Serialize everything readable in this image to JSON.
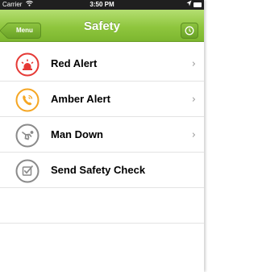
{
  "status_bar": {
    "carrier": "Carrier",
    "time": "3:50 PM"
  },
  "nav": {
    "back_label": "Menu",
    "title": "Safety"
  },
  "rows": [
    {
      "label": "Red Alert",
      "icon": "alert-siren-icon",
      "color": "#e53935",
      "has_chevron": true
    },
    {
      "label": "Amber Alert",
      "icon": "phone-icon",
      "color": "#f5a623",
      "has_chevron": true
    },
    {
      "label": "Man Down",
      "icon": "fallen-person-icon",
      "color": "#8a8a8a",
      "has_chevron": true
    },
    {
      "label": "Send Safety Check",
      "icon": "checkbox-icon",
      "color": "#8a8a8a",
      "has_chevron": false
    }
  ],
  "chevron_glyph": "›",
  "colors": {
    "navbar_green": "#8fc63e",
    "status_bar": "#1f1f1f"
  }
}
